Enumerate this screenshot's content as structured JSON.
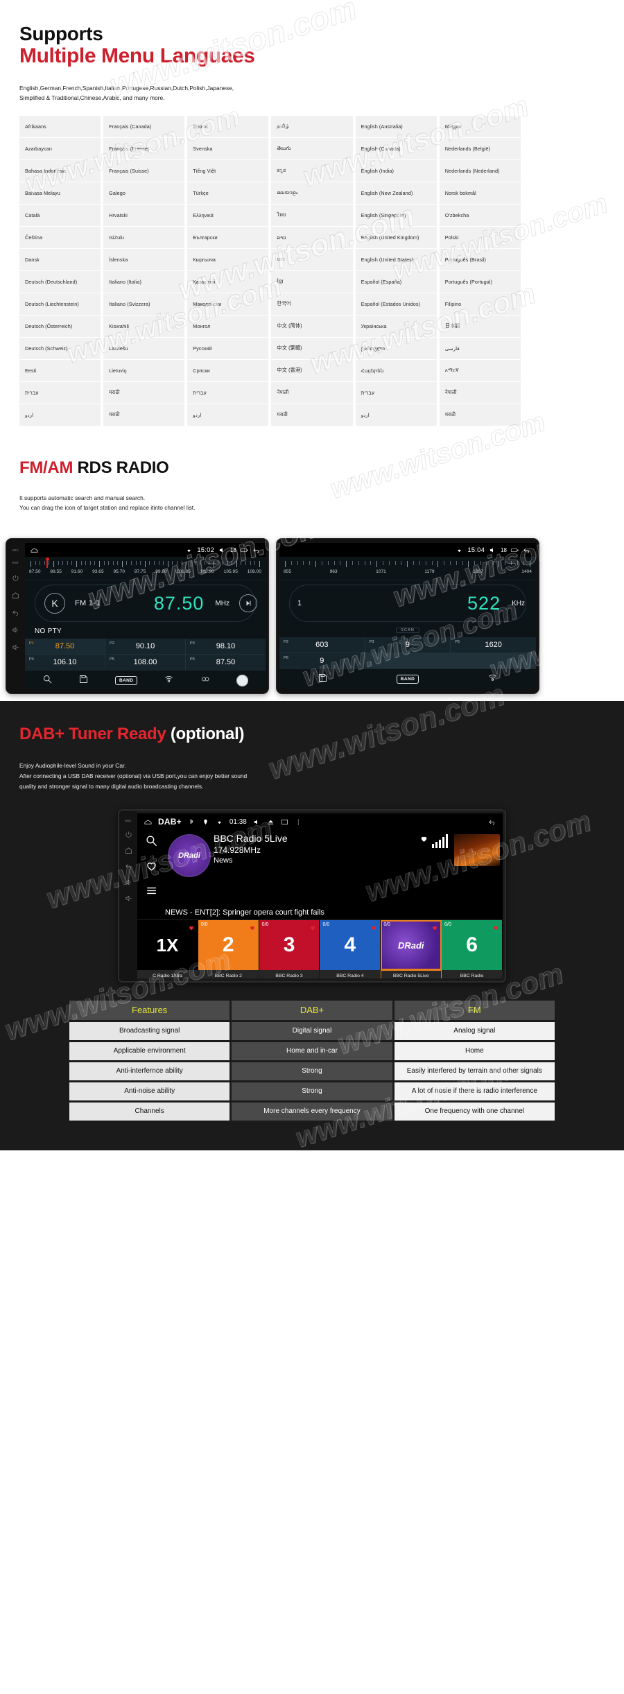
{
  "languages_section": {
    "title_line1": "Supports",
    "title_line2": "Multiple Menu Languaes",
    "desc_line1": "English,German,French,Spanish,Italian,Portugese,Russian,Dutch,Polish,Japanese,",
    "desc_line2": "Simplified & Traditional,Chinese,Arabic, and many more.",
    "columns": [
      [
        "Afrikaans",
        "Azarbaycan",
        "Bahasa Indonesia",
        "Bahasa Melayu",
        "Català",
        "Čeština",
        "Dansk",
        "Deutsch (Deutschland)",
        "Deutsch (Liechtenstein)",
        "Deutsch (Österreich)",
        "Deutsch (Schweiz)",
        "Eesti",
        "עברית",
        "اردو"
      ],
      [
        "Français (Canada)",
        "Français (France)",
        "Français (Suisse)",
        "Galego",
        "Hrvatski",
        "IsiZulu",
        "Íslenska",
        "Italiano (Italia)",
        "Italiano (Svizzera)",
        "Kiswahili",
        "Latviešu",
        "Lietuvių",
        "मराठी",
        "मराठी"
      ],
      [
        "Suomi",
        "Svenska",
        "Tiếng Việt",
        "Türkçe",
        "Ελληνικά",
        "Български",
        "Кыргызча",
        "Қазақ тілі",
        "Македонски",
        "Монгол",
        "Русский",
        "Српски",
        "עברית",
        "اردو"
      ],
      [
        "தமிழ்",
        "తెలుగు",
        "ಕನ್ನಡ",
        "മലയാളം",
        "ไทย",
        "ລາວ",
        "ಅಉ",
        "ខ្មែរ",
        "한국어",
        "中文 (简体)",
        "中文 (繁體)",
        "中文 (香港)",
        "नेपाली",
        "मराठी"
      ],
      [
        "English (Australia)",
        "English (Canada)",
        "English (India)",
        "English (New Zealand)",
        "English (Singapore)",
        "English (United Kingdom)",
        "English (United States)",
        "Español (España)",
        "Español (Estados Unidos)",
        "Українська",
        "ქართული",
        "Հայերեն",
        "עברית",
        "اردو"
      ],
      [
        "Magyar",
        "Nederlands (België)",
        "Nederlands (Nederland)",
        "Norsk bokmål",
        "O'zbekcha",
        "Polski",
        "Português (Brasil)",
        "Português (Portugal)",
        "Filipino",
        "日本語",
        "فارسی",
        "አማርኛ",
        "नेपाली",
        "मराठी"
      ]
    ]
  },
  "fm_section": {
    "title_red": "FM/AM",
    "title_black": " RDS RADIO",
    "desc_line1": "It supports automatic search and manual search.",
    "desc_line2": "You can drag the icon of target station and replace itinto channel list.",
    "device_main": {
      "rail": {
        "mic": "MIC",
        "rst": "RST"
      },
      "status": {
        "time": "15:02",
        "volume": "18"
      },
      "scale_labels": [
        "87.50",
        "89.55",
        "91.60",
        "93.65",
        "95.70",
        "97.75",
        "99.80",
        "101.85",
        "103.90",
        "105.95",
        "108.00"
      ],
      "rds_badge": "K",
      "band": "FM 1-1",
      "frequency": "87.50",
      "unit": "MHz",
      "pty": "NO PTY",
      "presets": [
        {
          "num": "P1",
          "value": "87.50",
          "active": true
        },
        {
          "num": "P2",
          "value": "90.10",
          "active": false
        },
        {
          "num": "P3",
          "value": "98.10",
          "active": false
        },
        {
          "num": "P4",
          "value": "106.10",
          "active": false
        },
        {
          "num": "P5",
          "value": "108.00",
          "active": false
        },
        {
          "num": "P6",
          "value": "87.50",
          "active": false
        }
      ],
      "toolbar": {
        "band_label": "BAND"
      }
    },
    "device_side": {
      "status": {
        "time": "15:04",
        "volume": "18"
      },
      "scale_labels": [
        "855",
        "963",
        "1071",
        "1179",
        "1287",
        "1404"
      ],
      "band": "1",
      "frequency": "522",
      "unit": "KHz",
      "scan": "SCAN",
      "presets": [
        {
          "num": "P2",
          "value": "603",
          "active": false
        },
        {
          "num": "P3",
          "value": "9",
          "active": false
        },
        {
          "num": "P5",
          "value": "1620",
          "active": false
        },
        {
          "num": "P6",
          "value": "9",
          "active": false
        }
      ],
      "toolbar": {
        "band_label": "BAND"
      }
    }
  },
  "dab_section": {
    "title_red": "DAB+ Tuner Ready ",
    "title_white": "(optional)",
    "desc_line1": "Enjoy Audiophile-level Sound in your Car.",
    "desc_line2": "After connecting a USB DAB receiver (optional) via USB port,you can enjoy better sound",
    "desc_line3": "quality and stronger signal to many digital audio broadcasting channels.",
    "device": {
      "rail": {
        "mic": "MIC"
      },
      "app_name": "DAB+",
      "time": "01:38",
      "disc_label": "DRadi",
      "station": "BBC Radio 5Live",
      "frequency": "174.928MHz",
      "genre": "News",
      "ticker": "NEWS - ENT[2]: Springer opera court fight fails",
      "tiles": [
        {
          "badge": "",
          "label": "1X",
          "class": "t1",
          "name": "C Radio 1Xtra",
          "selected": false
        },
        {
          "badge": "0/0",
          "label": "2",
          "class": "t2",
          "name": "BBC Radio 2",
          "selected": false
        },
        {
          "badge": "0/0",
          "label": "3",
          "class": "t3",
          "name": "BBC Radio 3",
          "selected": false
        },
        {
          "badge": "0/0",
          "label": "4",
          "class": "t4",
          "name": "BBC Radio 4",
          "selected": false
        },
        {
          "badge": "0/0",
          "label": "DRadi",
          "class": "t5",
          "name": "BBC Radio 5Live",
          "selected": true
        },
        {
          "badge": "0/0",
          "label": "6",
          "class": "t6",
          "name": "BBC Radio",
          "selected": false
        }
      ]
    },
    "comparison": {
      "headers": [
        "Features",
        "DAB+",
        "FM"
      ],
      "rows": [
        [
          "Broadcasting signal",
          "Digital signal",
          "Analog signal"
        ],
        [
          "Applicable environment",
          "Home and in-car",
          "Home"
        ],
        [
          "Anti-interfernce ability",
          "Strong",
          "Easily interfered by terrain and other signals"
        ],
        [
          "Anti-noise ability",
          "Strong",
          "A lot of nosie if there is radio interference"
        ],
        [
          "Channels",
          "More channels every frequency",
          "One frequency with one channel"
        ]
      ]
    }
  },
  "watermark": {
    "text": "www.witson.com"
  },
  "colors": {
    "brand_red": "#ce1f2d",
    "dab_red": "#e4262f",
    "freq_cyan": "#2fe3c0",
    "preset_amber": "#f0a020",
    "header_yellow": "#e5e53a"
  }
}
